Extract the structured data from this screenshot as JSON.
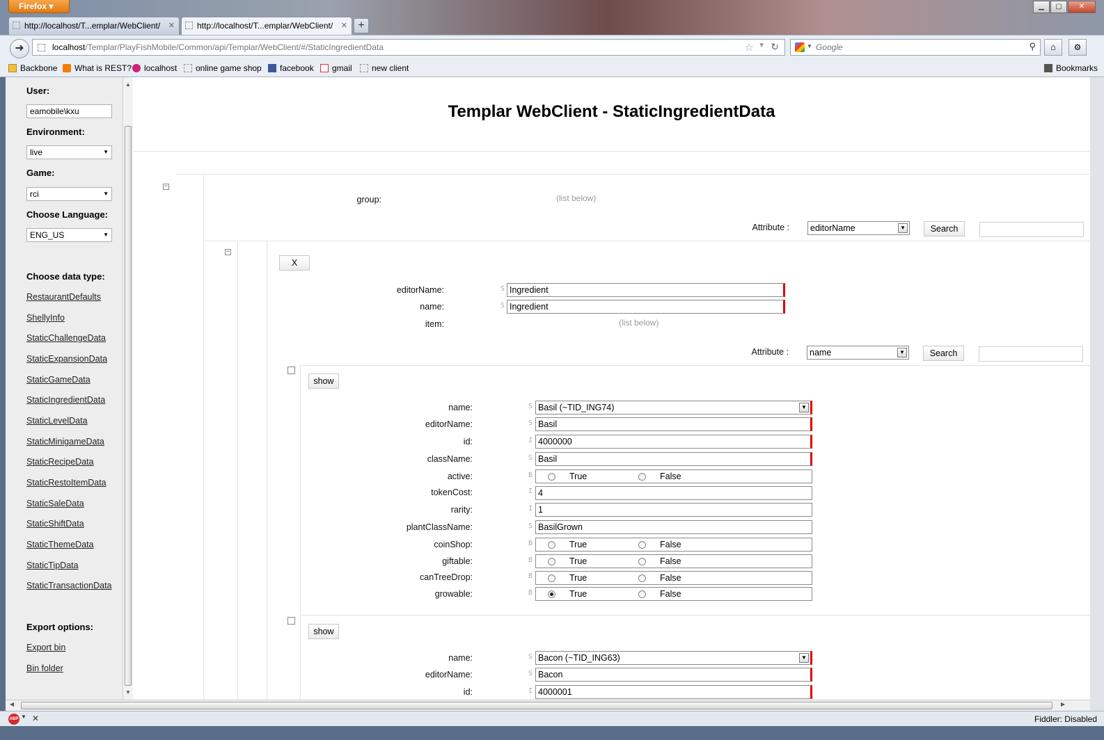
{
  "browser": {
    "app_button": "Firefox",
    "tabs": [
      {
        "label": "http://localhost/T...emplar/WebClient/"
      },
      {
        "label": "http://localhost/T...emplar/WebClient/"
      }
    ],
    "url_host": "localhost",
    "url_path": "/Templar/PlayFishMobile/Common/api/Templar/WebClient/#/StaticIngredientData",
    "search_placeholder": "Google",
    "bookmarks": [
      "Backbone",
      "What is REST?",
      "localhost",
      "online game shop",
      "facebook",
      "gmail",
      "new client"
    ],
    "bookmarks_menu": "Bookmarks",
    "status_right": "Fiddler: Disabled"
  },
  "sidebar": {
    "user_label": "User:",
    "user_value": "eamobile\\kxu",
    "env_label": "Environment:",
    "env_value": "live",
    "game_label": "Game:",
    "game_value": "rci",
    "lang_label": "Choose Language:",
    "lang_value": "ENG_US",
    "datatype_label": "Choose data type:",
    "datatypes": [
      "RestaurantDefaults",
      "ShellyInfo",
      "StaticChallengeData",
      "StaticExpansionData",
      "StaticGameData",
      "StaticIngredientData",
      "StaticLevelData",
      "StaticMinigameData",
      "StaticRecipeData",
      "StaticRestoItemData",
      "StaticSaleData",
      "StaticShiftData",
      "StaticThemeData",
      "StaticTipData",
      "StaticTransactionData"
    ],
    "export_label": "Export options:",
    "export_links": [
      "Export bin",
      "Bin folder"
    ]
  },
  "main": {
    "title": "Templar WebClient - StaticIngredientData",
    "group_label": "group:",
    "list_below": "(list below)",
    "attribute_label": "Attribute :",
    "search_label": "Search",
    "group_attr_value": "editorName",
    "x_button": "X",
    "group_fields": {
      "editorName_label": "editorName:",
      "editorName_value": "Ingredient",
      "name_label": "name:",
      "name_value": "Ingredient",
      "item_label": "item:"
    },
    "item_attr_value": "name",
    "show_label": "show",
    "true_label": "True",
    "false_label": "False",
    "items": [
      {
        "name": "Basil (~TID_ING74)",
        "editorName": "Basil",
        "id": "4000000",
        "className": "Basil",
        "tokenCost": "4",
        "rarity": "1",
        "plantClassName": "BasilGrown",
        "growable": "True"
      },
      {
        "name": "Bacon (~TID_ING63)",
        "editorName": "Bacon",
        "id": "4000001"
      }
    ],
    "field_labels": {
      "name": "name:",
      "editorName": "editorName:",
      "id": "id:",
      "className": "className:",
      "active": "active:",
      "tokenCost": "tokenCost:",
      "rarity": "rarity:",
      "plantClassName": "plantClassName:",
      "coinShop": "coinShop:",
      "giftable": "giftable:",
      "canTreeDrop": "canTreeDrop:",
      "growable": "growable:"
    },
    "type_chars": {
      "string": "S",
      "int": "I",
      "bool": "B"
    }
  }
}
